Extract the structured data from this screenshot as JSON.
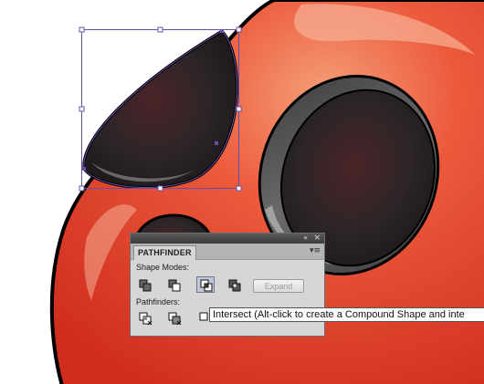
{
  "canvas": {
    "colors": {
      "body_red": "#e8432c",
      "body_highlight": "#f28a63",
      "eye_dark": "#2b2324",
      "outline": "#000000",
      "selection": "#6a4fa6"
    }
  },
  "panel": {
    "title": "PATHFINDER",
    "collapse_icon": "«",
    "close_icon": "×",
    "menu_icon": "▾≡",
    "shape_modes_label": "Shape Modes:",
    "pathfinders_label": "Pathfinders:",
    "expand_label": "Expand",
    "shape_modes": [
      {
        "name": "unite-icon",
        "pressed": false
      },
      {
        "name": "minus-front-icon",
        "pressed": false
      },
      {
        "name": "intersect-icon",
        "pressed": true
      },
      {
        "name": "exclude-icon",
        "pressed": false
      }
    ],
    "pathfinders": [
      {
        "name": "divide-icon"
      },
      {
        "name": "trim-icon"
      },
      {
        "name": "merge-icon"
      }
    ]
  },
  "tooltip": {
    "text": "Intersect (Alt-click to create a Compound Shape and inte"
  }
}
